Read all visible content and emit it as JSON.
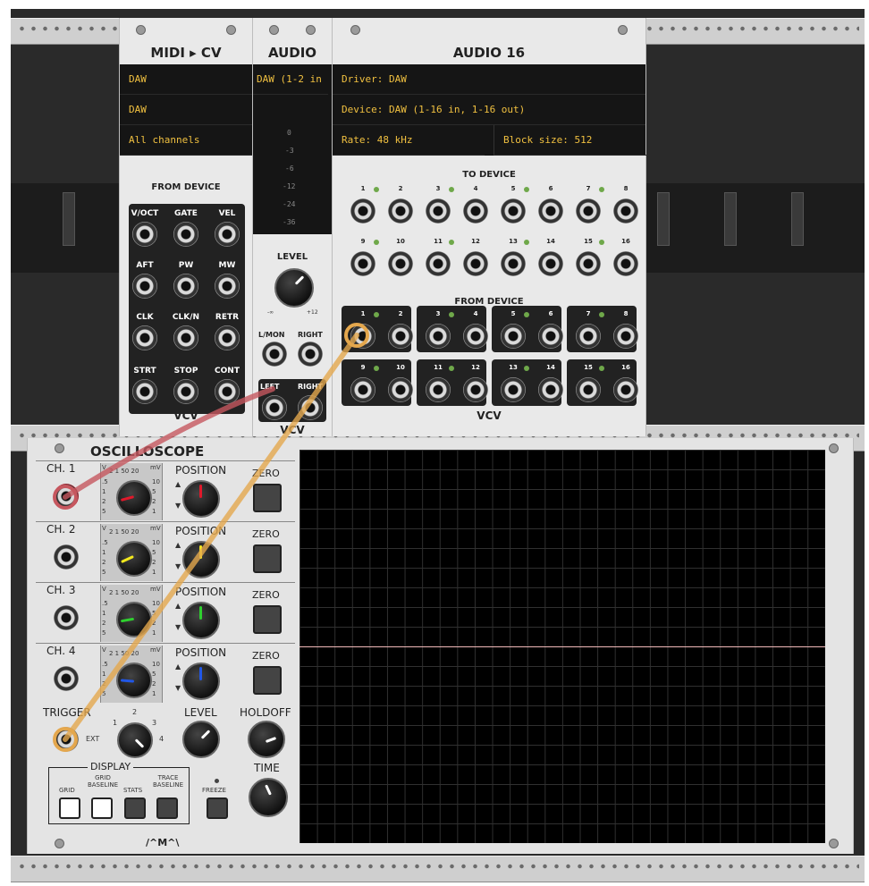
{
  "midi_cv": {
    "title": "MIDI ▸ CV",
    "lcd_rows": [
      "DAW",
      "DAW",
      "All channels"
    ],
    "section": "FROM DEVICE",
    "ports": [
      "V/OCT",
      "GATE",
      "VEL",
      "AFT",
      "PW",
      "MW",
      "CLK",
      "CLK/N",
      "RETR",
      "STRT",
      "STOP",
      "CONT"
    ],
    "brand": "VCV"
  },
  "audio": {
    "title": "AUDIO",
    "lcd_row": "DAW (1-2 in",
    "meter_labels": [
      "0",
      "-3",
      "-6",
      "-12",
      "-24",
      "-36"
    ],
    "level_label": "LEVEL",
    "level_min": "-∞",
    "level_max": "+12",
    "lmon_label": "L/MON",
    "right_label": "RIGHT",
    "left_label": "LEFT",
    "right_label2": "RIGHT",
    "brand": "VCV"
  },
  "audio16": {
    "title": "AUDIO 16",
    "driver": "Driver: DAW",
    "device": "Device: DAW (1-16 in, 1-16 out)",
    "rate": "Rate: 48 kHz",
    "block": "Block size: 512",
    "to_device": "TO DEVICE",
    "from_device": "FROM DEVICE",
    "nums": [
      "1",
      "2",
      "3",
      "4",
      "5",
      "6",
      "7",
      "8",
      "9",
      "10",
      "11",
      "12",
      "13",
      "14",
      "15",
      "16"
    ],
    "brand": "VCV"
  },
  "scope": {
    "title": "OSCILLOSCOPE",
    "channels": [
      "CH. 1",
      "CH. 2",
      "CH. 3",
      "CH. 4"
    ],
    "position": "POSITION",
    "zero": "ZERO",
    "scale_v": "V",
    "scale_mv": "mV",
    "scale_top": "2  1  50  20",
    "scale_right": [
      "10",
      "5",
      "2",
      "1"
    ],
    "scale_left": [
      ".5",
      "1",
      "2",
      "5"
    ],
    "trigger": "TRIGGER",
    "ext": "EXT",
    "trig_nums": [
      "1",
      "2",
      "3",
      "4"
    ],
    "level": "LEVEL",
    "holdoff": "HOLDOFF",
    "display": "DISPLAY",
    "grid": "GRID",
    "grid_baseline": "GRID BASELINE",
    "stats": "STATS",
    "trace_baseline": "TRACE BASELINE",
    "freeze": "FREEZE",
    "time": "TIME",
    "brand": "/^M^\\"
  },
  "colors": {
    "ch1": "#e0192b",
    "ch2": "#f2e81e",
    "ch3": "#2fd02f",
    "ch4": "#2157e6",
    "cable_pink": "#c6575f",
    "cable_orange": "#e4a74d"
  }
}
